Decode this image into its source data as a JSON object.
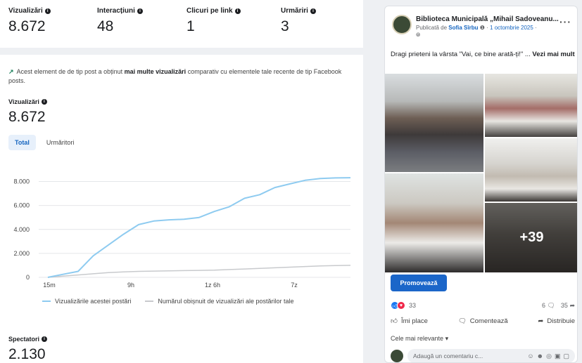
{
  "stats": [
    {
      "label": "Vizualizări",
      "value": "8.672"
    },
    {
      "label": "Interacțiuni",
      "value": "48"
    },
    {
      "label": "Clicuri pe link",
      "value": "1"
    },
    {
      "label": "Urmăriri",
      "value": "3"
    }
  ],
  "insight": {
    "pre": "Acest element de de tip post a obținut ",
    "bold": "mai multe vizualizări",
    "post": " comparativ cu elementele tale recente de tip Facebook posts."
  },
  "metric": {
    "label": "Vizualizări",
    "value": "8.672"
  },
  "tabs": [
    "Total",
    "Urmăritori"
  ],
  "legend": {
    "series1": "Vizualizările acestei postări",
    "series2": "Numărul obișnuit de vizualizări ale postărilor tale"
  },
  "spectators": {
    "label": "Spectatori",
    "value": "2.130"
  },
  "colors": {
    "series1": "#8ecbf0",
    "series2": "#c8cacd",
    "accent": "#1b66c9"
  },
  "chart_data": {
    "type": "line",
    "ylim": [
      0,
      8500
    ],
    "yticks": [
      0,
      2000,
      4000,
      6000,
      8000
    ],
    "ytick_labels": [
      "0",
      "2.000",
      "4.000",
      "6.000",
      "8.000"
    ],
    "xticks": [
      "15m",
      "9h",
      "1z 6h",
      "7z"
    ],
    "series": [
      {
        "name": "Vizualizările acestei postări",
        "values": [
          0,
          250,
          500,
          1800,
          2700,
          3600,
          4400,
          4700,
          4800,
          4850,
          5000,
          5500,
          5900,
          6600,
          6900,
          7500,
          7800,
          8100,
          8250,
          8300,
          8320
        ]
      },
      {
        "name": "Numărul obișnuit de vizualizări ale postărilor tale",
        "values": [
          0,
          100,
          200,
          300,
          400,
          450,
          500,
          520,
          540,
          560,
          580,
          600,
          650,
          700,
          750,
          800,
          850,
          900,
          950,
          980,
          1000
        ]
      }
    ]
  },
  "post": {
    "page_name": "Biblioteca Municipală „Mihail Sadoveanu...",
    "published_by": "Publicată de ",
    "author": "Sofia Sîrbu",
    "date": "1 octombrie 2025",
    "text": "Dragi prieteni la vârsta \"Vai, ce bine arată-ți!\" ... ",
    "see_more": "Vezi mai mult",
    "more_photos": "+39",
    "promote": "Promovează",
    "reactions_count": "33",
    "comments_count": "6",
    "shares_count": "35",
    "like": "Îmi place",
    "comment": "Comentează",
    "share": "Distribuie",
    "most_relevant": "Cele mai relevante",
    "comment_placeholder": "Adaugă un comentariu c..."
  }
}
